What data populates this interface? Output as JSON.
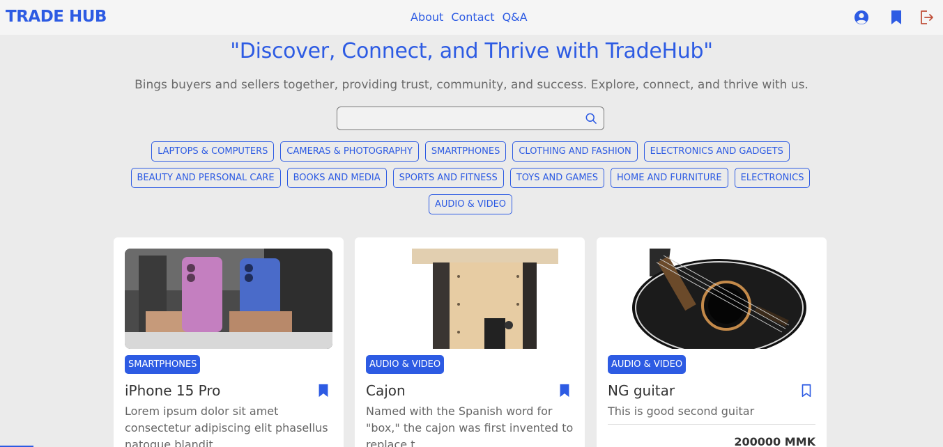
{
  "brand": {
    "name": "TRADE HUB"
  },
  "nav": {
    "links": [
      "About",
      "Contact",
      "Q&A"
    ],
    "icons": [
      "user-circle-icon",
      "bookmark-icon",
      "logout-icon"
    ]
  },
  "hero": {
    "title": "\"Discover, Connect, and Thrive with TradeHub\"",
    "subtitle": "Bings buyers and sellers together, providing trust, community, and success. Explore, connect, and thrive with us."
  },
  "search": {
    "value": "",
    "placeholder": ""
  },
  "categories": [
    "LAPTOPS & COMPUTERS",
    "CAMERAS & PHOTOGRAPHY",
    "SMARTPHONES",
    "CLOTHING AND FASHION",
    "ELECTRONICS AND GADGETS",
    "BEAUTY AND PERSONAL CARE",
    "BOOKS AND MEDIA",
    "SPORTS AND FITNESS",
    "TOYS AND GAMES",
    "HOME AND FURNITURE",
    "ELECTRONICS",
    "AUDIO & VIDEO"
  ],
  "products": [
    {
      "category": "SMARTPHONES",
      "title": "iPhone 15 Pro",
      "description": "Lorem ipsum dolor sit amet consectetur adipiscing elit phasellus natoque blandit",
      "bookmarked": true,
      "image": "two-phones-photo"
    },
    {
      "category": "AUDIO & VIDEO",
      "title": "Cajon",
      "description": "Named with the Spanish word for \"box,\" the cajon was first invented to replace t",
      "bookmarked": true,
      "image": "cajon-drum-photo"
    },
    {
      "category": "AUDIO & VIDEO",
      "title": "NG guitar",
      "description": "This is good second guitar",
      "price": "200000 MMK",
      "bookmarked": false,
      "image": "acoustic-guitar-photo"
    }
  ],
  "colors": {
    "accent": "#2d5be3",
    "background": "#ebebeb",
    "navbar": "#f5f5f5",
    "logout": "#c0503a"
  }
}
